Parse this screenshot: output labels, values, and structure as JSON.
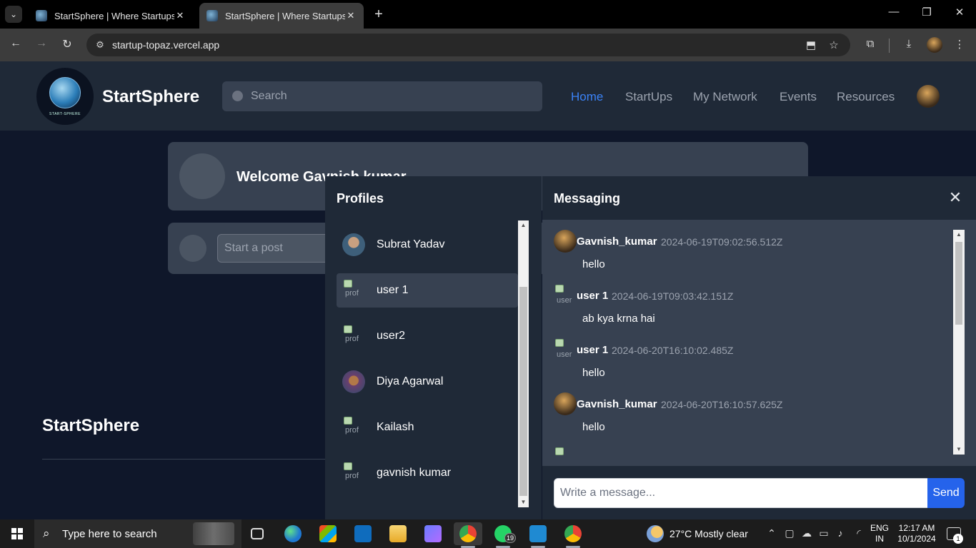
{
  "browser": {
    "tabs": [
      {
        "title": "StartSphere | Where Startups Ta"
      },
      {
        "title": "StartSphere | Where Startups Ta"
      }
    ],
    "url": "startup-topaz.vercel.app"
  },
  "header": {
    "logo_text": "START-SPHERE",
    "brand": "StartSphere",
    "search_placeholder": "Search",
    "nav": [
      "Home",
      "StartUps",
      "My Network",
      "Events",
      "Resources"
    ],
    "active_nav": "Home"
  },
  "main": {
    "welcome": "Welcome Gavnish kumar",
    "post_placeholder": "Start a post",
    "footer_brand": "StartSphere"
  },
  "profiles": {
    "title": "Profiles",
    "items": [
      {
        "name": "Subrat Yadav",
        "avatar": "photo"
      },
      {
        "name": "user 1",
        "avatar": "broken",
        "selected": true
      },
      {
        "name": "user2",
        "avatar": "broken"
      },
      {
        "name": "Diya Agarwal",
        "avatar": "photo"
      },
      {
        "name": "Kailash",
        "avatar": "broken"
      },
      {
        "name": "gavnish kumar",
        "avatar": "broken"
      }
    ]
  },
  "messaging": {
    "title": "Messaging",
    "messages": [
      {
        "sender": "Gavnish_kumar",
        "time": "2024-06-19T09:02:56.512Z",
        "text": "hello"
      },
      {
        "sender": "user 1",
        "time": "2024-06-19T09:03:42.151Z",
        "text": "ab kya krna hai"
      },
      {
        "sender": "user 1",
        "time": "2024-06-20T16:10:02.485Z",
        "text": "hello"
      },
      {
        "sender": "Gavnish_kumar",
        "time": "2024-06-20T16:10:57.625Z",
        "text": "hello"
      }
    ],
    "input_placeholder": "Write a message...",
    "send_label": "Send"
  },
  "taskbar": {
    "search_placeholder": "Type here to search",
    "whatsapp_badge": "19",
    "weather": "27°C  Mostly clear",
    "lang_top": "ENG",
    "lang_bottom": "IN",
    "time": "12:17 AM",
    "date": "10/1/2024",
    "notification_count": "1"
  },
  "colors": {
    "page_bg": "#0f172a",
    "panel_bg": "#1f2937",
    "card_bg": "#374151",
    "accent": "#3b82f6",
    "send_button": "#2563eb"
  }
}
